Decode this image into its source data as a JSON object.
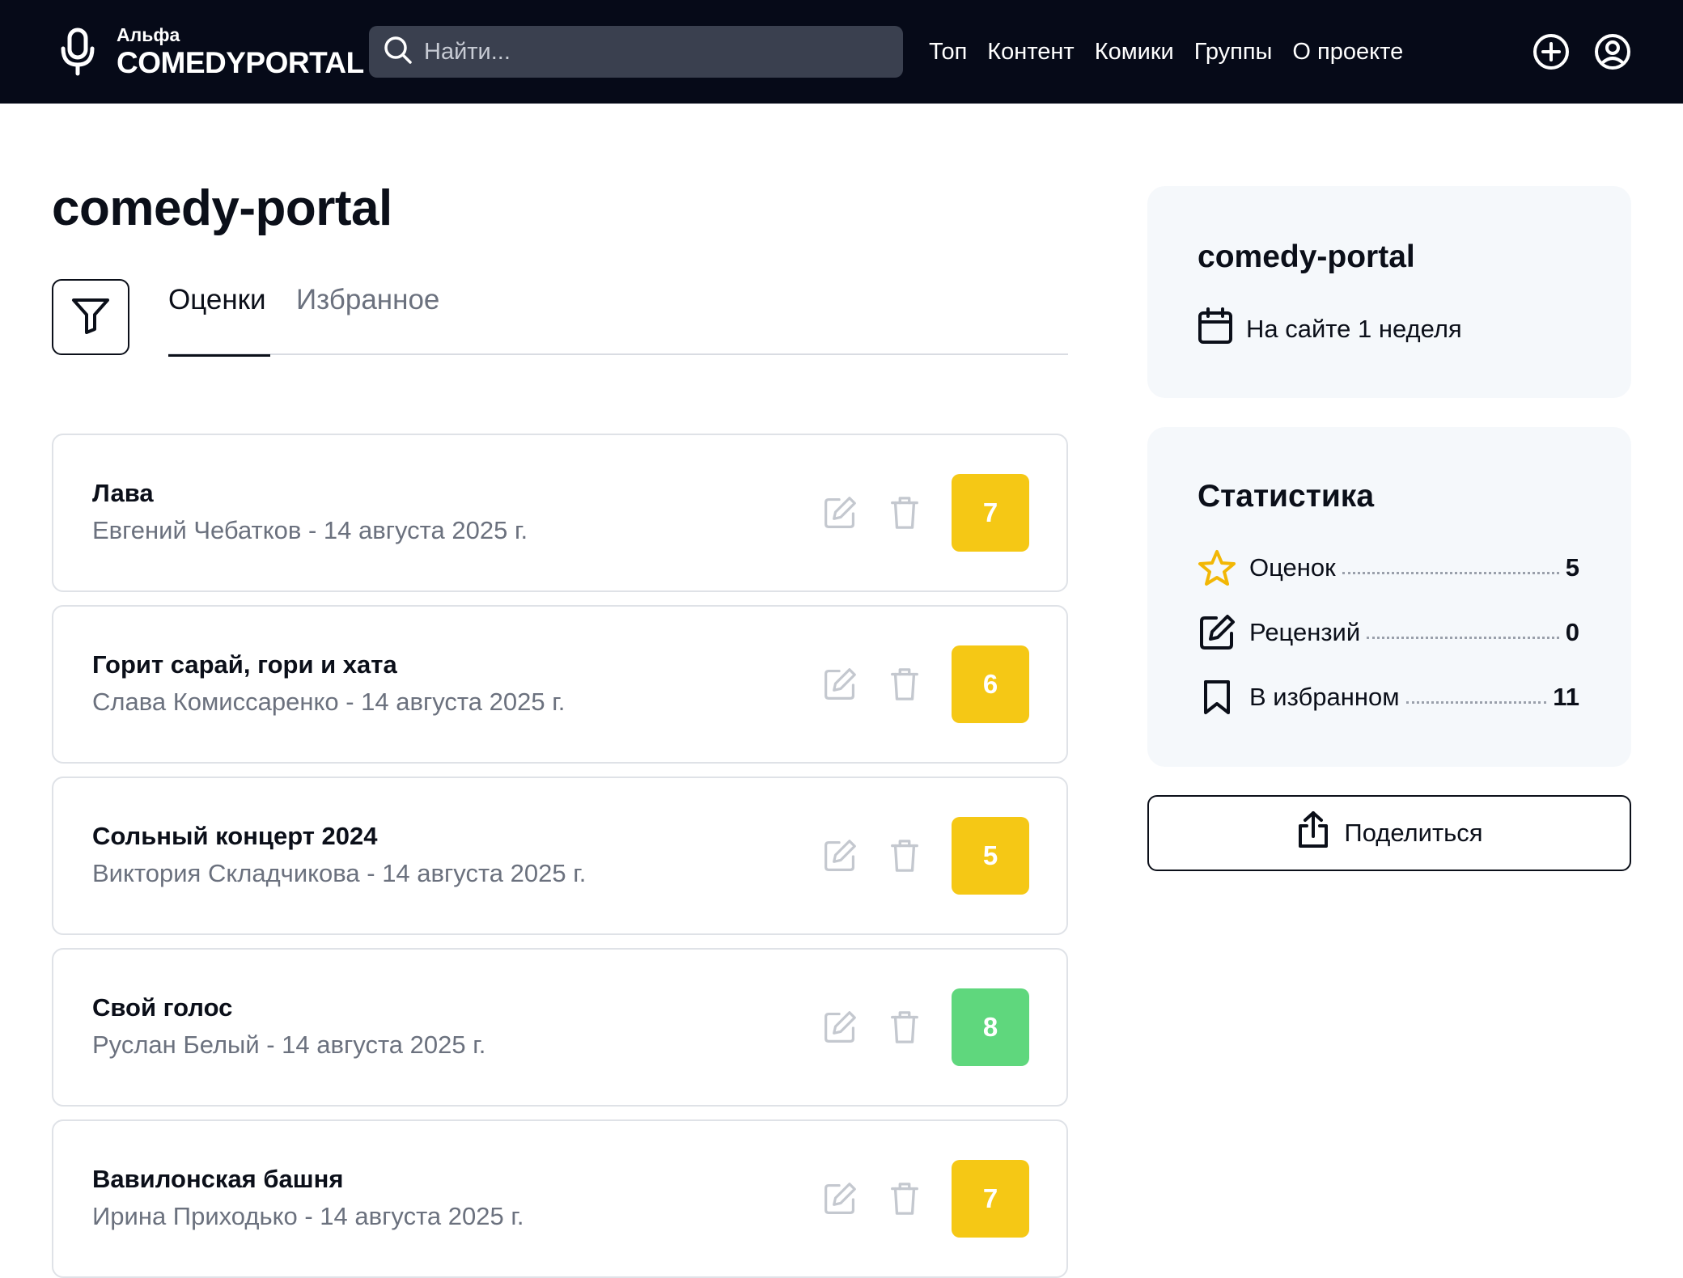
{
  "header": {
    "logo_sub": "Альфа",
    "logo_main": "COMEDYPORTAL",
    "search_placeholder": "Найти...",
    "nav": [
      "Топ",
      "Контент",
      "Комики",
      "Группы",
      "О проекте"
    ]
  },
  "main": {
    "title": "comedy-portal",
    "tabs": [
      {
        "label": "Оценки",
        "active": true
      },
      {
        "label": "Избранное",
        "active": false
      }
    ],
    "ratings": [
      {
        "title": "Лава",
        "meta": "Евгений Чебатков - 14 августа 2025 г.",
        "score": "7",
        "color": "#f5c815"
      },
      {
        "title": "Горит сарай, гори и хата",
        "meta": "Слава Комиссаренко - 14 августа 2025 г.",
        "score": "6",
        "color": "#f5c815"
      },
      {
        "title": "Сольный концерт 2024",
        "meta": "Виктория Складчикова - 14 августа 2025 г.",
        "score": "5",
        "color": "#f5c815"
      },
      {
        "title": "Свой голос",
        "meta": "Руслан Белый - 14 августа 2025 г.",
        "score": "8",
        "color": "#5fd77d"
      },
      {
        "title": "Вавилонская башня",
        "meta": "Ирина Приходько - 14 августа 2025 г.",
        "score": "7",
        "color": "#f5c815"
      }
    ]
  },
  "profile": {
    "name": "comedy-portal",
    "since": "На сайте 1 неделя"
  },
  "stats": {
    "heading": "Статистика",
    "rows": [
      {
        "label": "Оценок",
        "value": "5",
        "icon": "star-icon"
      },
      {
        "label": "Рецензий",
        "value": "0",
        "icon": "edit-icon"
      },
      {
        "label": "В избранном",
        "value": "11",
        "icon": "bookmark-icon"
      }
    ]
  },
  "share_label": "Поделиться",
  "colors": {
    "topbar": "#060a18",
    "yellow": "#f5c815",
    "green": "#5fd77d",
    "panel": "#f5f8fb"
  }
}
